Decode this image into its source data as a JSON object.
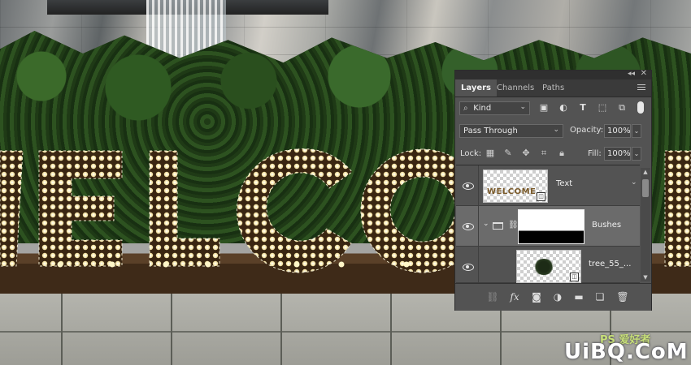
{
  "panel": {
    "tabs": [
      {
        "label": "Layers",
        "active": true
      },
      {
        "label": "Channels",
        "active": false
      },
      {
        "label": "Paths",
        "active": false
      }
    ],
    "filter": {
      "kind": "Kind"
    },
    "blend_mode": "Pass Through",
    "opacity_label": "Opacity:",
    "opacity_value": "100%",
    "lock_label": "Lock:",
    "fill_label": "Fill:",
    "fill_value": "100%",
    "layers": [
      {
        "name": "Text",
        "thumb_text": "WELCOME",
        "selected": false
      },
      {
        "name": "Bushes",
        "selected": true
      },
      {
        "name": "tree_55_...",
        "selected": false
      }
    ]
  },
  "colors": {
    "panel_bg": "#535353",
    "selected_row": "#6b6b6b",
    "bulb": "#f3e2a6",
    "letter_frame": "#3a2612"
  },
  "watermark": {
    "line1": "PS 爱好者",
    "line2": "UiBQ.CoM"
  }
}
